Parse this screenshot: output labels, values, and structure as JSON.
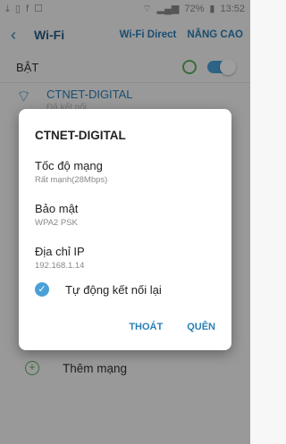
{
  "statusbar": {
    "left_icons": [
      "download-icon",
      "sim-icon",
      "facebook-icon",
      "notification-icon"
    ],
    "battery": "72%",
    "time": "13:52"
  },
  "appbar": {
    "title": "Wi-Fi",
    "action_wifi_direct": "Wi-Fi Direct",
    "action_advanced": "NÂNG CAO"
  },
  "wifi_toggle": {
    "label": "BẬT",
    "state": "on"
  },
  "network": {
    "name": "CTNET-DIGITAL",
    "status": "Đã kết nối"
  },
  "add_network": {
    "label": "Thêm mạng"
  },
  "dialog": {
    "title": "CTNET-DIGITAL",
    "items": [
      {
        "label": "Tốc độ mạng",
        "value": "Rất mạnh(28Mbps)"
      },
      {
        "label": "Bảo mật",
        "value": "WPA2 PSK"
      },
      {
        "label": "Địa chỉ IP",
        "value": "192.168.1.14"
      }
    ],
    "auto_reconnect": {
      "label": "Tự động kết nối lại",
      "checked": true
    },
    "btn_exit": "THOÁT",
    "btn_forget": "QUÊN"
  },
  "colors": {
    "accent": "#2a7fb6",
    "toggle": "#4aa0d8",
    "green": "#5ab05c"
  }
}
